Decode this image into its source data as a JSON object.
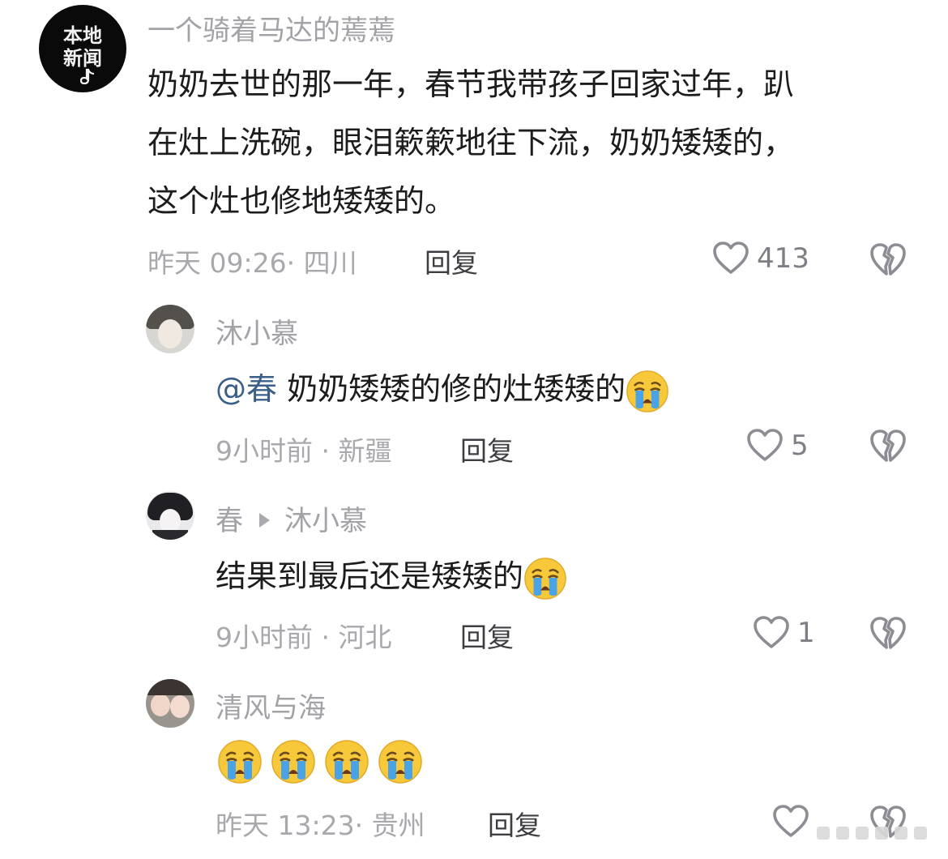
{
  "comments": [
    {
      "username": "一个骑着马达的蔫蔫",
      "avatar_text_top": "本地",
      "avatar_text_bottom": "新闻",
      "text_line1": "奶奶去世的那一年，春节我带孩子回家过年，趴",
      "text_line2": "在灶上洗碗，眼泪簌簌地往下流，奶奶矮矮的，",
      "text_line3": "这个灶也修地矮矮的。",
      "time_location": "昨天 09:26· 四川",
      "reply_label": "回复",
      "likes": "413",
      "icons": [
        "heart-outline-icon",
        "broken-heart-icon"
      ]
    },
    {
      "username": "沐小慕",
      "mention": "@春",
      "text": "奶奶矮矮的修的灶矮矮的",
      "emoji": "crying-face-emoji",
      "time_location": "9小时前 · 新疆",
      "reply_label": "回复",
      "likes": "5"
    },
    {
      "username": "春",
      "reply_to": "沐小慕",
      "text": "结果到最后还是矮矮的",
      "emoji": "crying-face-emoji",
      "time_location": "9小时前 · 河北",
      "reply_label": "回复",
      "likes": "1"
    },
    {
      "username": "清风与海",
      "emoji_count": 4,
      "emoji": "crying-face-emoji",
      "time_location": "昨天 13:23· 贵州",
      "reply_label": "回复"
    }
  ],
  "colors": {
    "meta_gray": "#a8a8ad",
    "mention_blue": "#3b5f86",
    "emoji_yellow": "#f6c83a",
    "tear_blue": "#4aa3e6"
  }
}
